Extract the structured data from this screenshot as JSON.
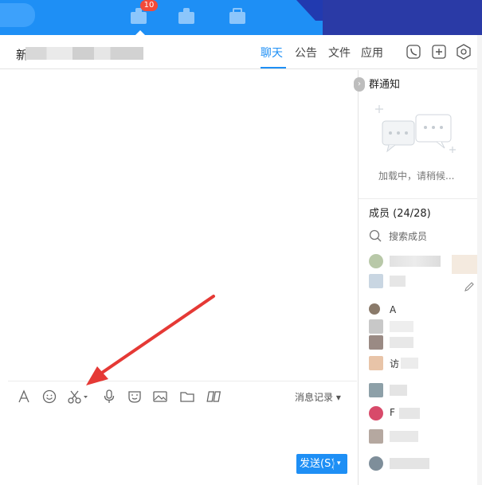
{
  "topbar": {
    "badge_count": "10",
    "icons": [
      "chat-icon",
      "contacts-icon",
      "workbench-icon"
    ],
    "accent_color": "#1e8ff5"
  },
  "header": {
    "group_name_initial": "新",
    "tabs": [
      {
        "label": "聊天",
        "active": true
      },
      {
        "label": "公告",
        "active": false
      },
      {
        "label": "文件",
        "active": false
      },
      {
        "label": "应用",
        "active": false
      }
    ],
    "buttons": [
      "call-icon",
      "add-member-icon",
      "settings-icon"
    ]
  },
  "toolbar": {
    "tools": [
      "font-icon",
      "emoji-icon",
      "screenshot-icon",
      "voice-icon",
      "sticker-icon",
      "image-icon",
      "folder-icon",
      "more-apps-icon"
    ],
    "history_label": "消息记录 ▾"
  },
  "send": {
    "label": "发送(S)",
    "arrow": "▾"
  },
  "notice": {
    "title": "群通知",
    "loading": "加载中，请稍候..."
  },
  "members": {
    "title": "成员 (24/28)",
    "search_placeholder": "搜索成员",
    "list": [
      {
        "text": "",
        "color": "#b8c8a8"
      },
      {
        "text": "",
        "color": "#c9d6e2"
      },
      {
        "text": "A",
        "color": "#8a7a6a"
      },
      {
        "text": "",
        "color": "#c8c8c8"
      },
      {
        "text": "",
        "color": "#9a8a84"
      },
      {
        "text": "访",
        "color": "#e8c4a8"
      },
      {
        "text": "",
        "color": "#8da0a8"
      },
      {
        "text": "F",
        "color": "#d84a6a"
      },
      {
        "text": "",
        "color": "#b5a8a0"
      },
      {
        "text": "",
        "color": "#7e8e9a"
      }
    ]
  }
}
